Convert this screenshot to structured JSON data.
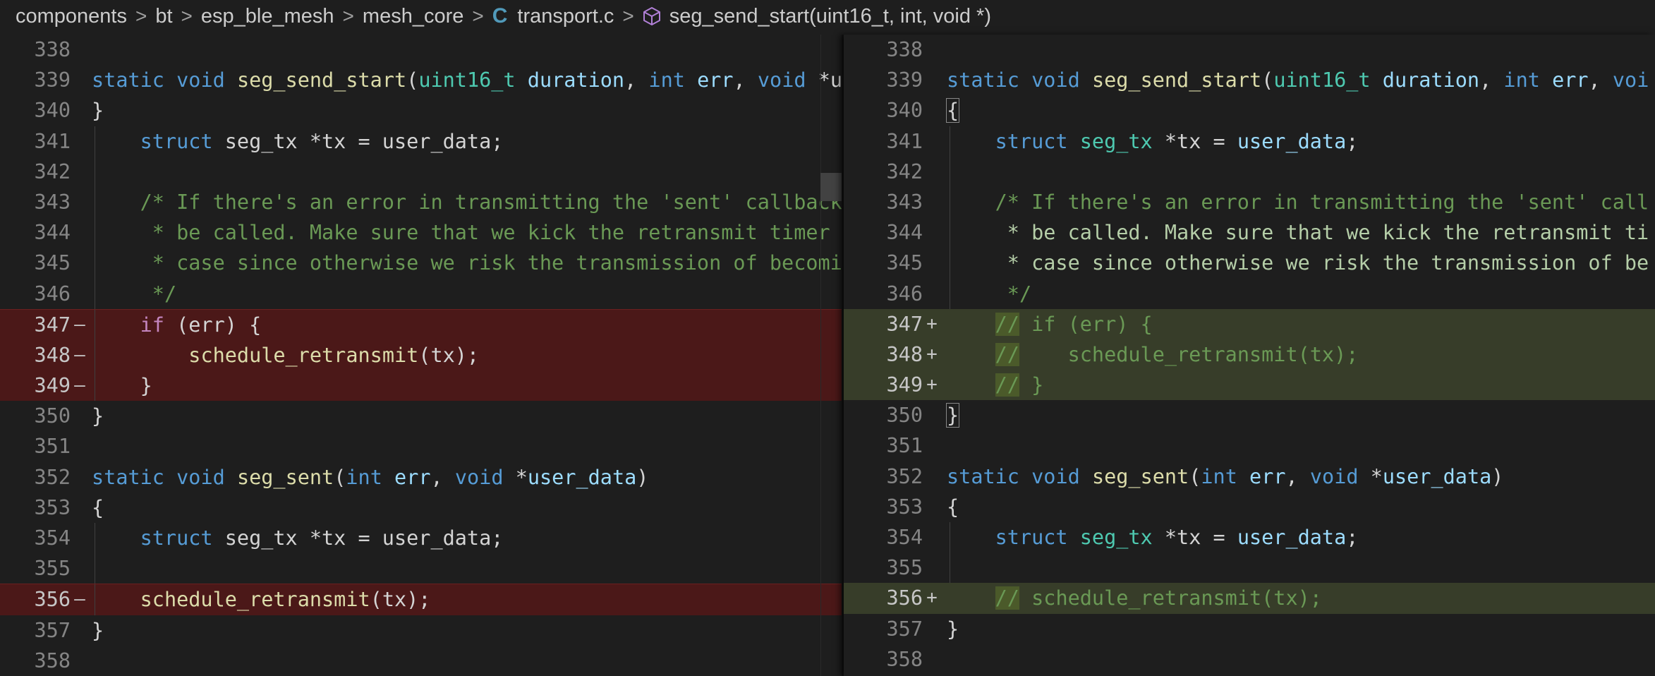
{
  "breadcrumb": {
    "items": [
      "components",
      "bt",
      "esp_ble_mesh",
      "mesh_core",
      "transport.c",
      "seg_send_start(uint16_t, int, void *)"
    ],
    "separator": ">"
  },
  "left": {
    "lines": [
      {
        "n": "338",
        "m": ""
      },
      {
        "n": "339",
        "m": ""
      },
      {
        "n": "340",
        "m": ""
      },
      {
        "n": "341",
        "m": ""
      },
      {
        "n": "342",
        "m": ""
      },
      {
        "n": "343",
        "m": ""
      },
      {
        "n": "344",
        "m": ""
      },
      {
        "n": "345",
        "m": ""
      },
      {
        "n": "346",
        "m": ""
      },
      {
        "n": "347",
        "m": "—"
      },
      {
        "n": "348",
        "m": "—"
      },
      {
        "n": "349",
        "m": "—"
      },
      {
        "n": "350",
        "m": ""
      },
      {
        "n": "351",
        "m": ""
      },
      {
        "n": "352",
        "m": ""
      },
      {
        "n": "353",
        "m": ""
      },
      {
        "n": "354",
        "m": ""
      },
      {
        "n": "355",
        "m": ""
      },
      {
        "n": "356",
        "m": "—"
      },
      {
        "n": "357",
        "m": ""
      },
      {
        "n": "358",
        "m": ""
      }
    ],
    "code": {
      "l339": {
        "kw1": "static",
        "kw2": "void",
        "fn": "seg_send_start",
        "p1": "(",
        "t1": "uint16_t",
        "v1": "duration",
        ",1": ",",
        "kw3": "int",
        "v2": "err",
        ",2": ",",
        "kw4": "void",
        "star": " *u"
      },
      "l341": {
        "kw": "struct",
        "rest": " seg_tx *tx = user_data;"
      },
      "l343": "/* If there's an error in transmitting the 'sent' callback",
      "l344": " * be called. Make sure that we kick the retransmit timer",
      "l345": " * case since otherwise we risk the transmission of becomi",
      "l346": " */",
      "l347": {
        "kw": "if",
        "rest": " (err) {"
      },
      "l348": {
        "fn": "schedule_retransmit",
        "rest": "(tx);"
      },
      "l349": "}",
      "l350": "}",
      "l352": {
        "kw1": "static",
        "kw2": "void",
        "fn": "seg_sent",
        "p": "(",
        "kw3": "int",
        "v1": "err",
        ",": ",",
        "kw4": "void",
        "star": "*",
        "v2": "user_data",
        "close": ")"
      },
      "l353": "{",
      "l354": {
        "kw": "struct",
        "rest": " seg_tx *tx = user_data;"
      },
      "l356": {
        "fn": "schedule_retransmit",
        "rest": "(tx);"
      },
      "l357": "}"
    }
  },
  "right": {
    "lines": [
      {
        "n": "338",
        "m": ""
      },
      {
        "n": "339",
        "m": ""
      },
      {
        "n": "340",
        "m": ""
      },
      {
        "n": "341",
        "m": ""
      },
      {
        "n": "342",
        "m": ""
      },
      {
        "n": "343",
        "m": ""
      },
      {
        "n": "344",
        "m": ""
      },
      {
        "n": "345",
        "m": ""
      },
      {
        "n": "346",
        "m": ""
      },
      {
        "n": "347",
        "m": "+"
      },
      {
        "n": "348",
        "m": "+"
      },
      {
        "n": "349",
        "m": "+"
      },
      {
        "n": "350",
        "m": ""
      },
      {
        "n": "351",
        "m": ""
      },
      {
        "n": "352",
        "m": ""
      },
      {
        "n": "353",
        "m": ""
      },
      {
        "n": "354",
        "m": ""
      },
      {
        "n": "355",
        "m": ""
      },
      {
        "n": "356",
        "m": "+"
      },
      {
        "n": "357",
        "m": ""
      },
      {
        "n": "358",
        "m": ""
      }
    ],
    "code": {
      "l339": {
        "kw1": "static",
        "kw2": "void",
        "fn": "seg_send_start",
        "p1": "(",
        "t1": "uint16_t",
        "v1": "duration",
        ",1": ",",
        "kw3": "int",
        "v2": "err",
        ",2": ",",
        "kw4": "voi"
      },
      "l340": "{",
      "l341": {
        "kw": "struct",
        "type": "seg_tx",
        "rest": " *tx = ",
        "v": "user_data",
        "end": ";"
      },
      "l343": "/* If there's an error in transmitting the 'sent' call",
      "l344": " * be called. Make sure that we kick the retransmit ti",
      "l345": " * case since otherwise we risk the transmission of be",
      "l346": " */",
      "l347": {
        "c": "//",
        "rest": " if (err) {"
      },
      "l348": {
        "c": "//",
        "rest": "    schedule_retransmit(tx);"
      },
      "l349": {
        "c": "//",
        "rest": " }"
      },
      "l350": "}",
      "l352": {
        "kw1": "static",
        "kw2": "void",
        "fn": "seg_sent",
        "p": "(",
        "kw3": "int",
        "v1": "err",
        ",": ",",
        "kw4": "void",
        "star": "*",
        "v2": "user_data",
        "close": ")"
      },
      "l353": "{",
      "l354": {
        "kw": "struct",
        "type": "seg_tx",
        "rest": " *tx = ",
        "v": "user_data",
        "end": ";"
      },
      "l356": {
        "c": "//",
        "rest": " schedule_retransmit(tx);"
      },
      "l357": "}"
    }
  },
  "colors": {
    "deleted_bg": "#4b1818",
    "inserted_bg": "#373d29",
    "keyword": "#569cd6",
    "function": "#dcdcaa",
    "comment": "#6a9955",
    "type": "#4ec9b0"
  }
}
